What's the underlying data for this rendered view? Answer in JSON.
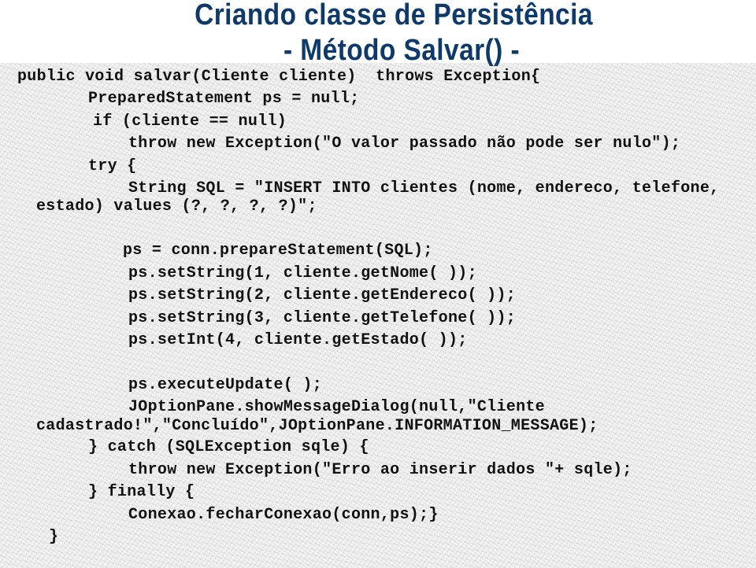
{
  "slide": {
    "title_line1": "Criando classe de Persistência",
    "title_line2": "- Método Salvar() -",
    "colors": {
      "title": "#0d3a6b",
      "code": "#111111",
      "background": "#ebebeb"
    }
  },
  "code": {
    "lines": [
      "public void salvar(Cliente cliente)  throws Exception{",
      "PreparedStatement ps = null;",
      "if (cliente == null)",
      "throw new Exception(\"O valor passado não pode ser nulo\");",
      "try {",
      "String SQL = \"INSERT INTO clientes (nome, endereco, telefone,",
      "estado) values (?, ?, ?, ?)\";",
      "ps = conn.prepareStatement(SQL);",
      "ps.setString(1, cliente.getNome( ));",
      "ps.setString(2, cliente.getEndereco( ));",
      "ps.setString(3, cliente.getTelefone( ));",
      "ps.setInt(4, cliente.getEstado( ));",
      "ps.executeUpdate( );",
      "JOptionPane.showMessageDialog(null,\"Cliente",
      "cadastrado!\",\"Concluído\",JOptionPane.INFORMATION_MESSAGE);",
      "} catch (SQLException sqle) {",
      "throw new Exception(\"Erro ao inserir dados \"+ sqle);",
      "} finally {",
      "Conexao.fecharConexao(conn,ps);}",
      "}"
    ]
  }
}
